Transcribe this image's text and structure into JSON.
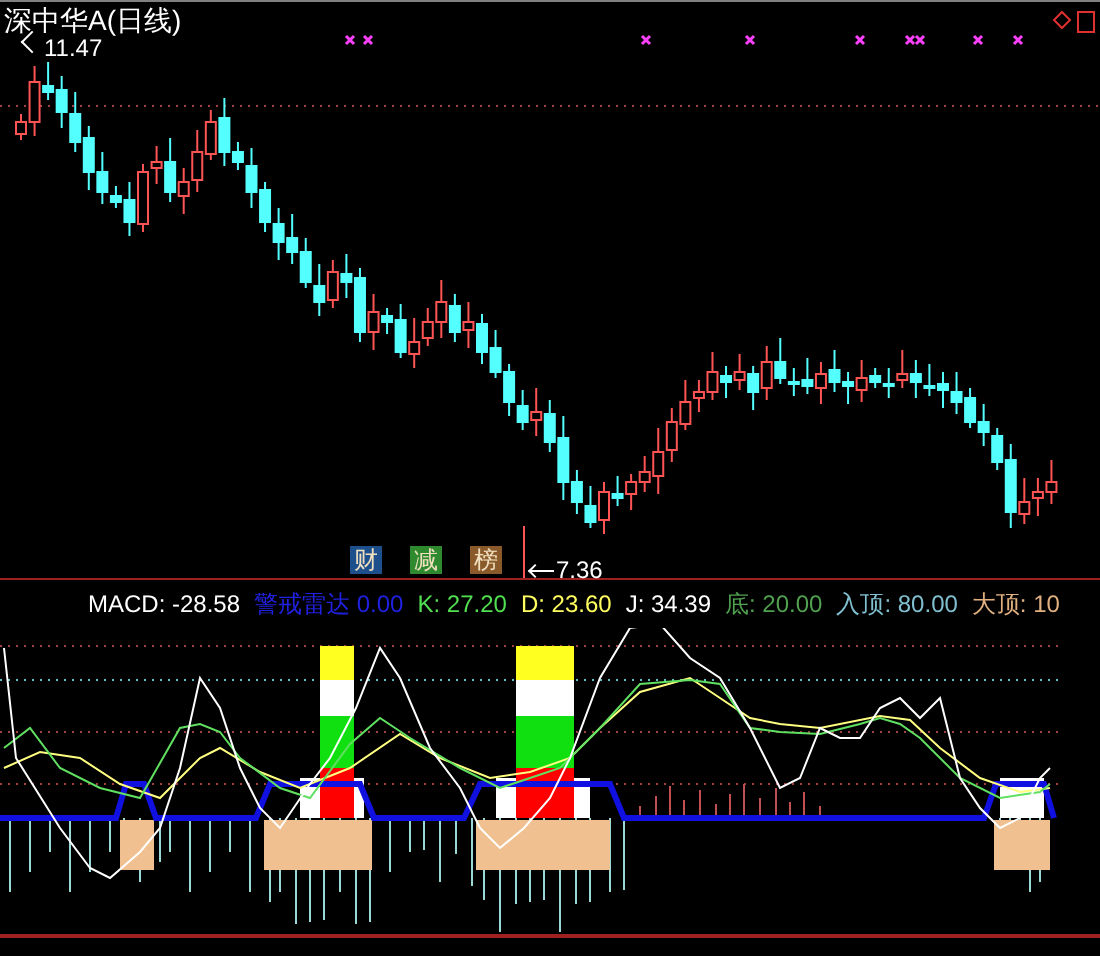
{
  "chart_title": "深中华A(日线)",
  "high_label": "11.47",
  "low_label": "7.36",
  "corner_icons": [
    {
      "kind": "diamond"
    },
    {
      "kind": "square"
    }
  ],
  "signal_badges": [
    {
      "text": "财",
      "color": "#1c4f8c"
    },
    {
      "text": "减",
      "color": "#2f8a2f"
    },
    {
      "text": "榜",
      "color": "#8a5a2a"
    }
  ],
  "indicator_values": [
    {
      "label": "MACD: -28.58",
      "color": "#ffffff"
    },
    {
      "label": "警戒雷达 0.00",
      "color": "#2020e0"
    },
    {
      "label": "K: 27.20",
      "color": "#50e050"
    },
    {
      "label": "D: 23.60",
      "color": "#ffff60"
    },
    {
      "label": "J: 34.39",
      "color": "#ffffff"
    },
    {
      "label": "底: 20.00",
      "color": "#50a050"
    },
    {
      "label": "入顶: 80.00",
      "color": "#80c0d0"
    },
    {
      "label": "大顶: 10",
      "color": "#e0b080"
    }
  ]
}
